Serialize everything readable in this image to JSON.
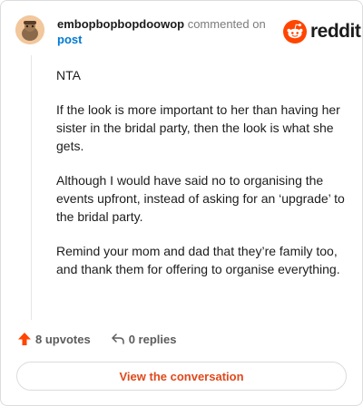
{
  "header": {
    "username": "embopbopbopdoowop",
    "action_text": "commented on",
    "post_link": "post"
  },
  "brand": {
    "logo_text": "reddit",
    "logo_color": "#ff4500",
    "logo_icon": "reddit-snoo-icon"
  },
  "comment": {
    "paragraphs": [
      "NTA",
      "If the look is more important to her than having her sister in the bridal party, then the look is what she gets.",
      "Although I would have said no to organising the events upfront, instead of asking for an ‘upgrade’ to the bridal party.",
      "Remind your mom and dad that they’re family too, and thank them for offering to organise everything."
    ]
  },
  "actions": {
    "upvotes_label": "8 upvotes",
    "upvote_icon": "upvote-arrow-icon",
    "upvote_color": "#ff4500",
    "replies_label": "0 replies",
    "reply_icon": "reply-arrow-icon"
  },
  "cta": {
    "label": "View the conversation",
    "color": "#e0491c"
  },
  "colors": {
    "link": "#0079d3",
    "muted": "#7c7c7c"
  }
}
